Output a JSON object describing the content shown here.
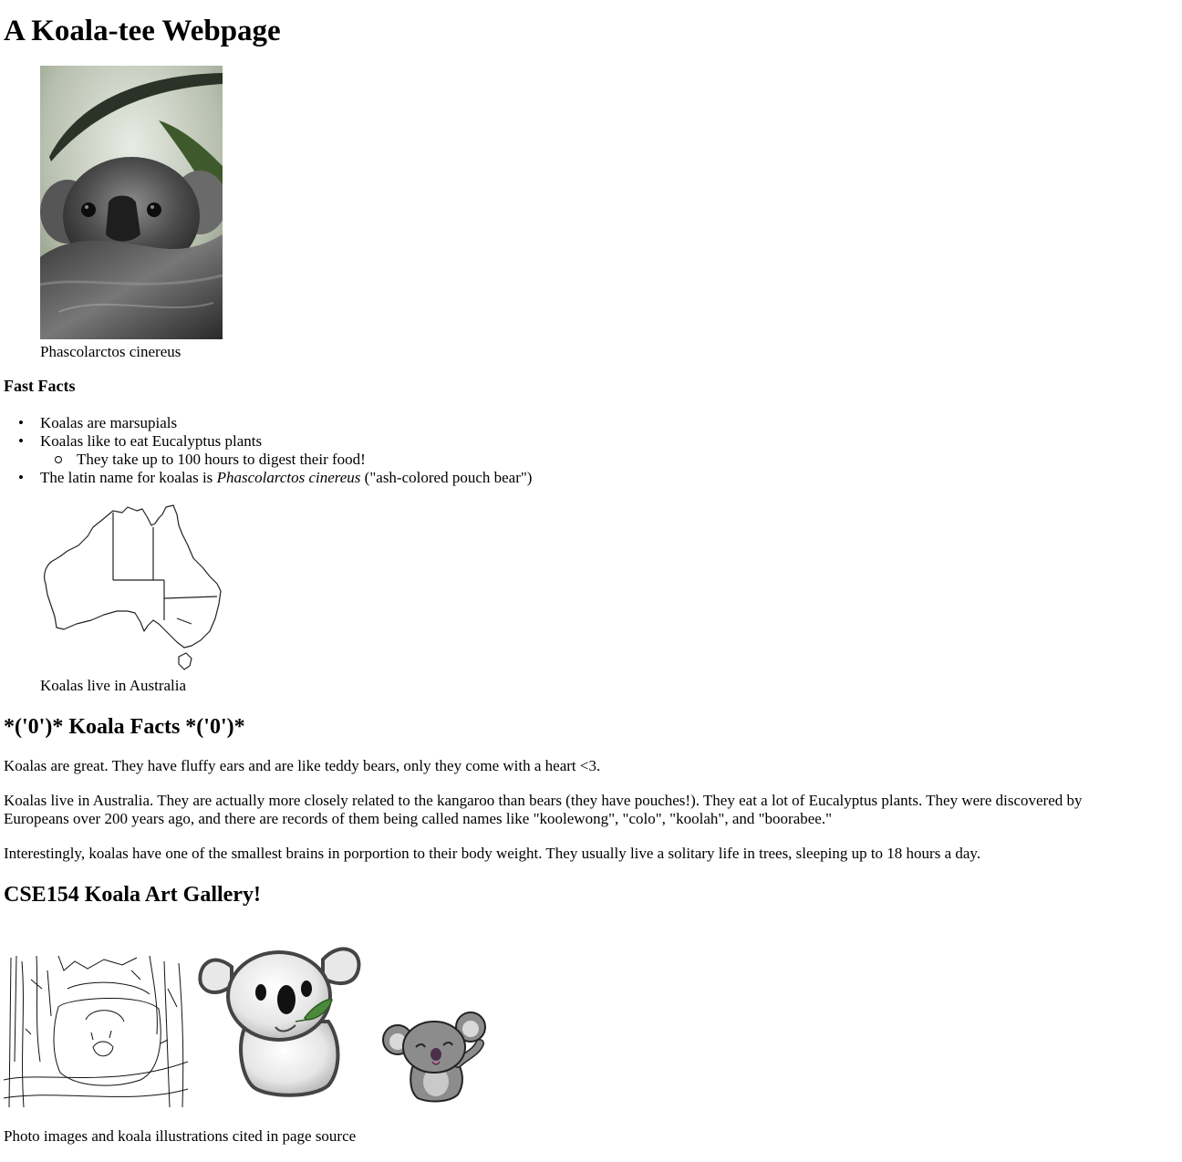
{
  "page": {
    "title": "A Koala-tee Webpage"
  },
  "photo_figure": {
    "caption": "Phascolarctos cinereus"
  },
  "fast_facts": {
    "heading": "Fast Facts",
    "items": [
      "Koalas are marsupials",
      "Koalas like to eat Eucalyptus plants",
      "They take up to 100 hours to digest their food!",
      "The latin name for koalas is ",
      "Phascolarctos cinereus",
      " (\"ash-colored pouch bear\")"
    ]
  },
  "map_figure": {
    "caption": "Koalas live in Australia"
  },
  "koala_facts": {
    "heading": "*('0')* Koala Facts *('0')*",
    "paragraphs": [
      "Koalas are great. They have fluffy ears and are like teddy bears, only they come with a heart <3.",
      "Koalas live in Australia. They are actually more closely related to the kangaroo than bears (they have pouches!). They eat a lot of Eucalyptus plants. They were discovered by",
      "Europeans over 200 years ago, and there are records of them being called names like \"koolewong\", \"colo\", \"koolah\", and \"boorabee.\"",
      "Interestingly, koalas have one of the smallest brains in porportion to their body weight. They usually live a solitary life in trees, sleeping up to 18 hours a day."
    ]
  },
  "gallery": {
    "heading": "CSE154 Koala Art Gallery!",
    "footer": "Photo images and koala illustrations cited in page source"
  }
}
